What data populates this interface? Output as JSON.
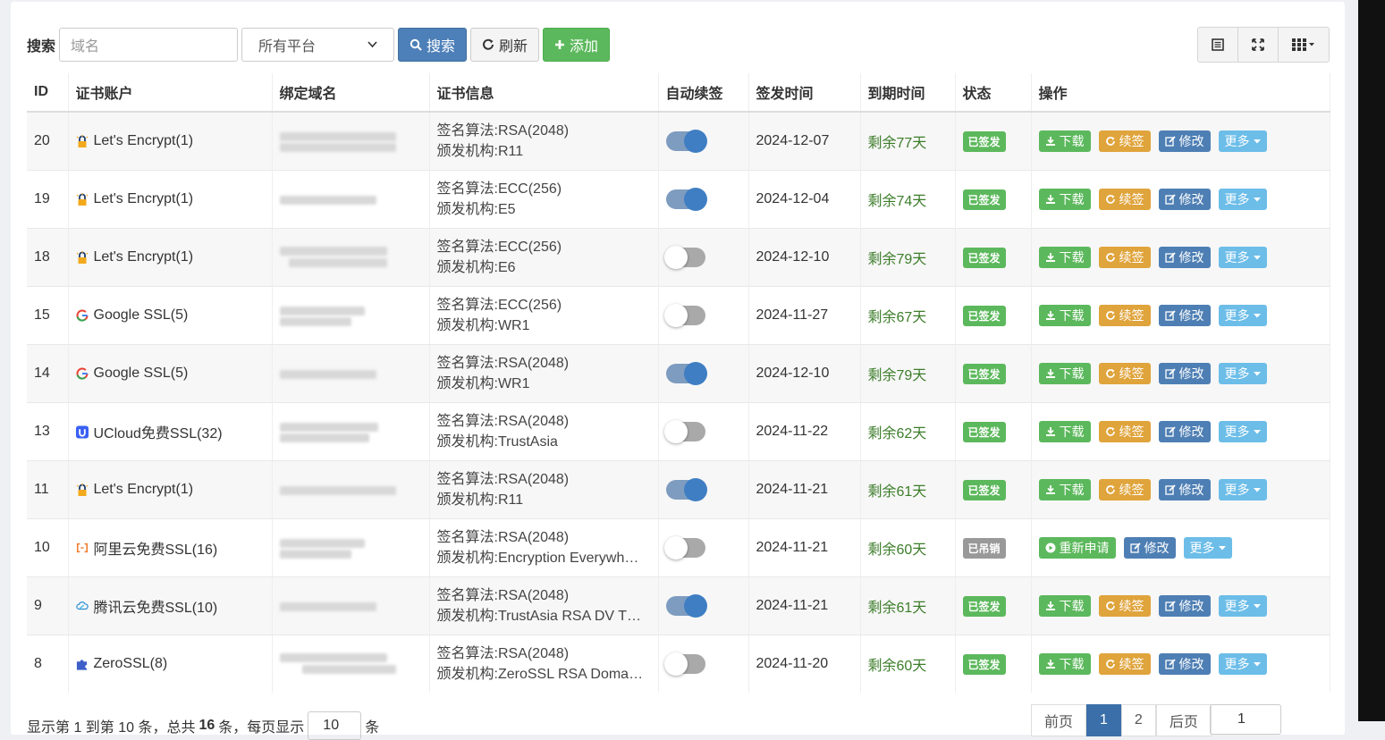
{
  "search": {
    "label": "搜索",
    "placeholder": "域名",
    "platform": "所有平台",
    "search_btn": "搜索",
    "refresh_btn": "刷新",
    "add_btn": "添加"
  },
  "columns": [
    "ID",
    "证书账户",
    "绑定域名",
    "证书信息",
    "自动续签",
    "签发时间",
    "到期时间",
    "状态",
    "操作"
  ],
  "actions": {
    "download": "下载",
    "renew": "续签",
    "edit": "修改",
    "more": "更多",
    "reapply": "重新申请"
  },
  "rows": [
    {
      "id": "20",
      "account": "Let's Encrypt(1)",
      "icon": "lock-icon",
      "algo": "签名算法:RSA(2048)",
      "issuer": "颁发机构:R11",
      "auto": true,
      "issued": "2024-12-07",
      "expire": "剩余77天",
      "status": "已签发",
      "status_type": "ok"
    },
    {
      "id": "19",
      "account": "Let's Encrypt(1)",
      "icon": "lock-icon",
      "algo": "签名算法:ECC(256)",
      "issuer": "颁发机构:E5",
      "auto": true,
      "issued": "2024-12-04",
      "expire": "剩余74天",
      "status": "已签发",
      "status_type": "ok"
    },
    {
      "id": "18",
      "account": "Let's Encrypt(1)",
      "icon": "lock-icon",
      "algo": "签名算法:ECC(256)",
      "issuer": "颁发机构:E6",
      "auto": false,
      "issued": "2024-12-10",
      "expire": "剩余79天",
      "status": "已签发",
      "status_type": "ok"
    },
    {
      "id": "15",
      "account": "Google SSL(5)",
      "icon": "google-icon",
      "algo": "签名算法:ECC(256)",
      "issuer": "颁发机构:WR1",
      "auto": false,
      "issued": "2024-11-27",
      "expire": "剩余67天",
      "status": "已签发",
      "status_type": "ok"
    },
    {
      "id": "14",
      "account": "Google SSL(5)",
      "icon": "google-icon",
      "algo": "签名算法:RSA(2048)",
      "issuer": "颁发机构:WR1",
      "auto": true,
      "issued": "2024-12-10",
      "expire": "剩余79天",
      "status": "已签发",
      "status_type": "ok"
    },
    {
      "id": "13",
      "account": "UCloud免费SSL(32)",
      "icon": "ucloud-icon",
      "algo": "签名算法:RSA(2048)",
      "issuer": "颁发机构:TrustAsia",
      "auto": false,
      "issued": "2024-11-22",
      "expire": "剩余62天",
      "status": "已签发",
      "status_type": "ok"
    },
    {
      "id": "11",
      "account": "Let's Encrypt(1)",
      "icon": "lock-icon",
      "algo": "签名算法:RSA(2048)",
      "issuer": "颁发机构:R11",
      "auto": true,
      "issued": "2024-11-21",
      "expire": "剩余61天",
      "status": "已签发",
      "status_type": "ok"
    },
    {
      "id": "10",
      "account": "阿里云免费SSL(16)",
      "icon": "aliyun-icon",
      "algo": "签名算法:RSA(2048)",
      "issuer": "颁发机构:Encryption Everywh…",
      "auto": false,
      "issued": "2024-11-21",
      "expire": "剩余60天",
      "status": "已吊销",
      "status_type": "rev"
    },
    {
      "id": "9",
      "account": "腾讯云免费SSL(10)",
      "icon": "cloud-icon",
      "algo": "签名算法:RSA(2048)",
      "issuer": "颁发机构:TrustAsia RSA DV T…",
      "auto": true,
      "issued": "2024-11-21",
      "expire": "剩余61天",
      "status": "已签发",
      "status_type": "ok"
    },
    {
      "id": "8",
      "account": "ZeroSSL(8)",
      "icon": "puzzle-icon",
      "algo": "签名算法:RSA(2048)",
      "issuer": "颁发机构:ZeroSSL RSA Doma…",
      "auto": false,
      "issued": "2024-11-20",
      "expire": "剩余60天",
      "status": "已签发",
      "status_type": "ok"
    }
  ],
  "footer": {
    "summary_prefix": "显示第 1 到第 10 条，总共",
    "total": "16",
    "summary_mid": "条，每页显示",
    "per_page": "10",
    "summary_suffix": "条"
  },
  "pager": [
    "前页",
    "1",
    "2",
    "后页"
  ],
  "goto_value": "1"
}
